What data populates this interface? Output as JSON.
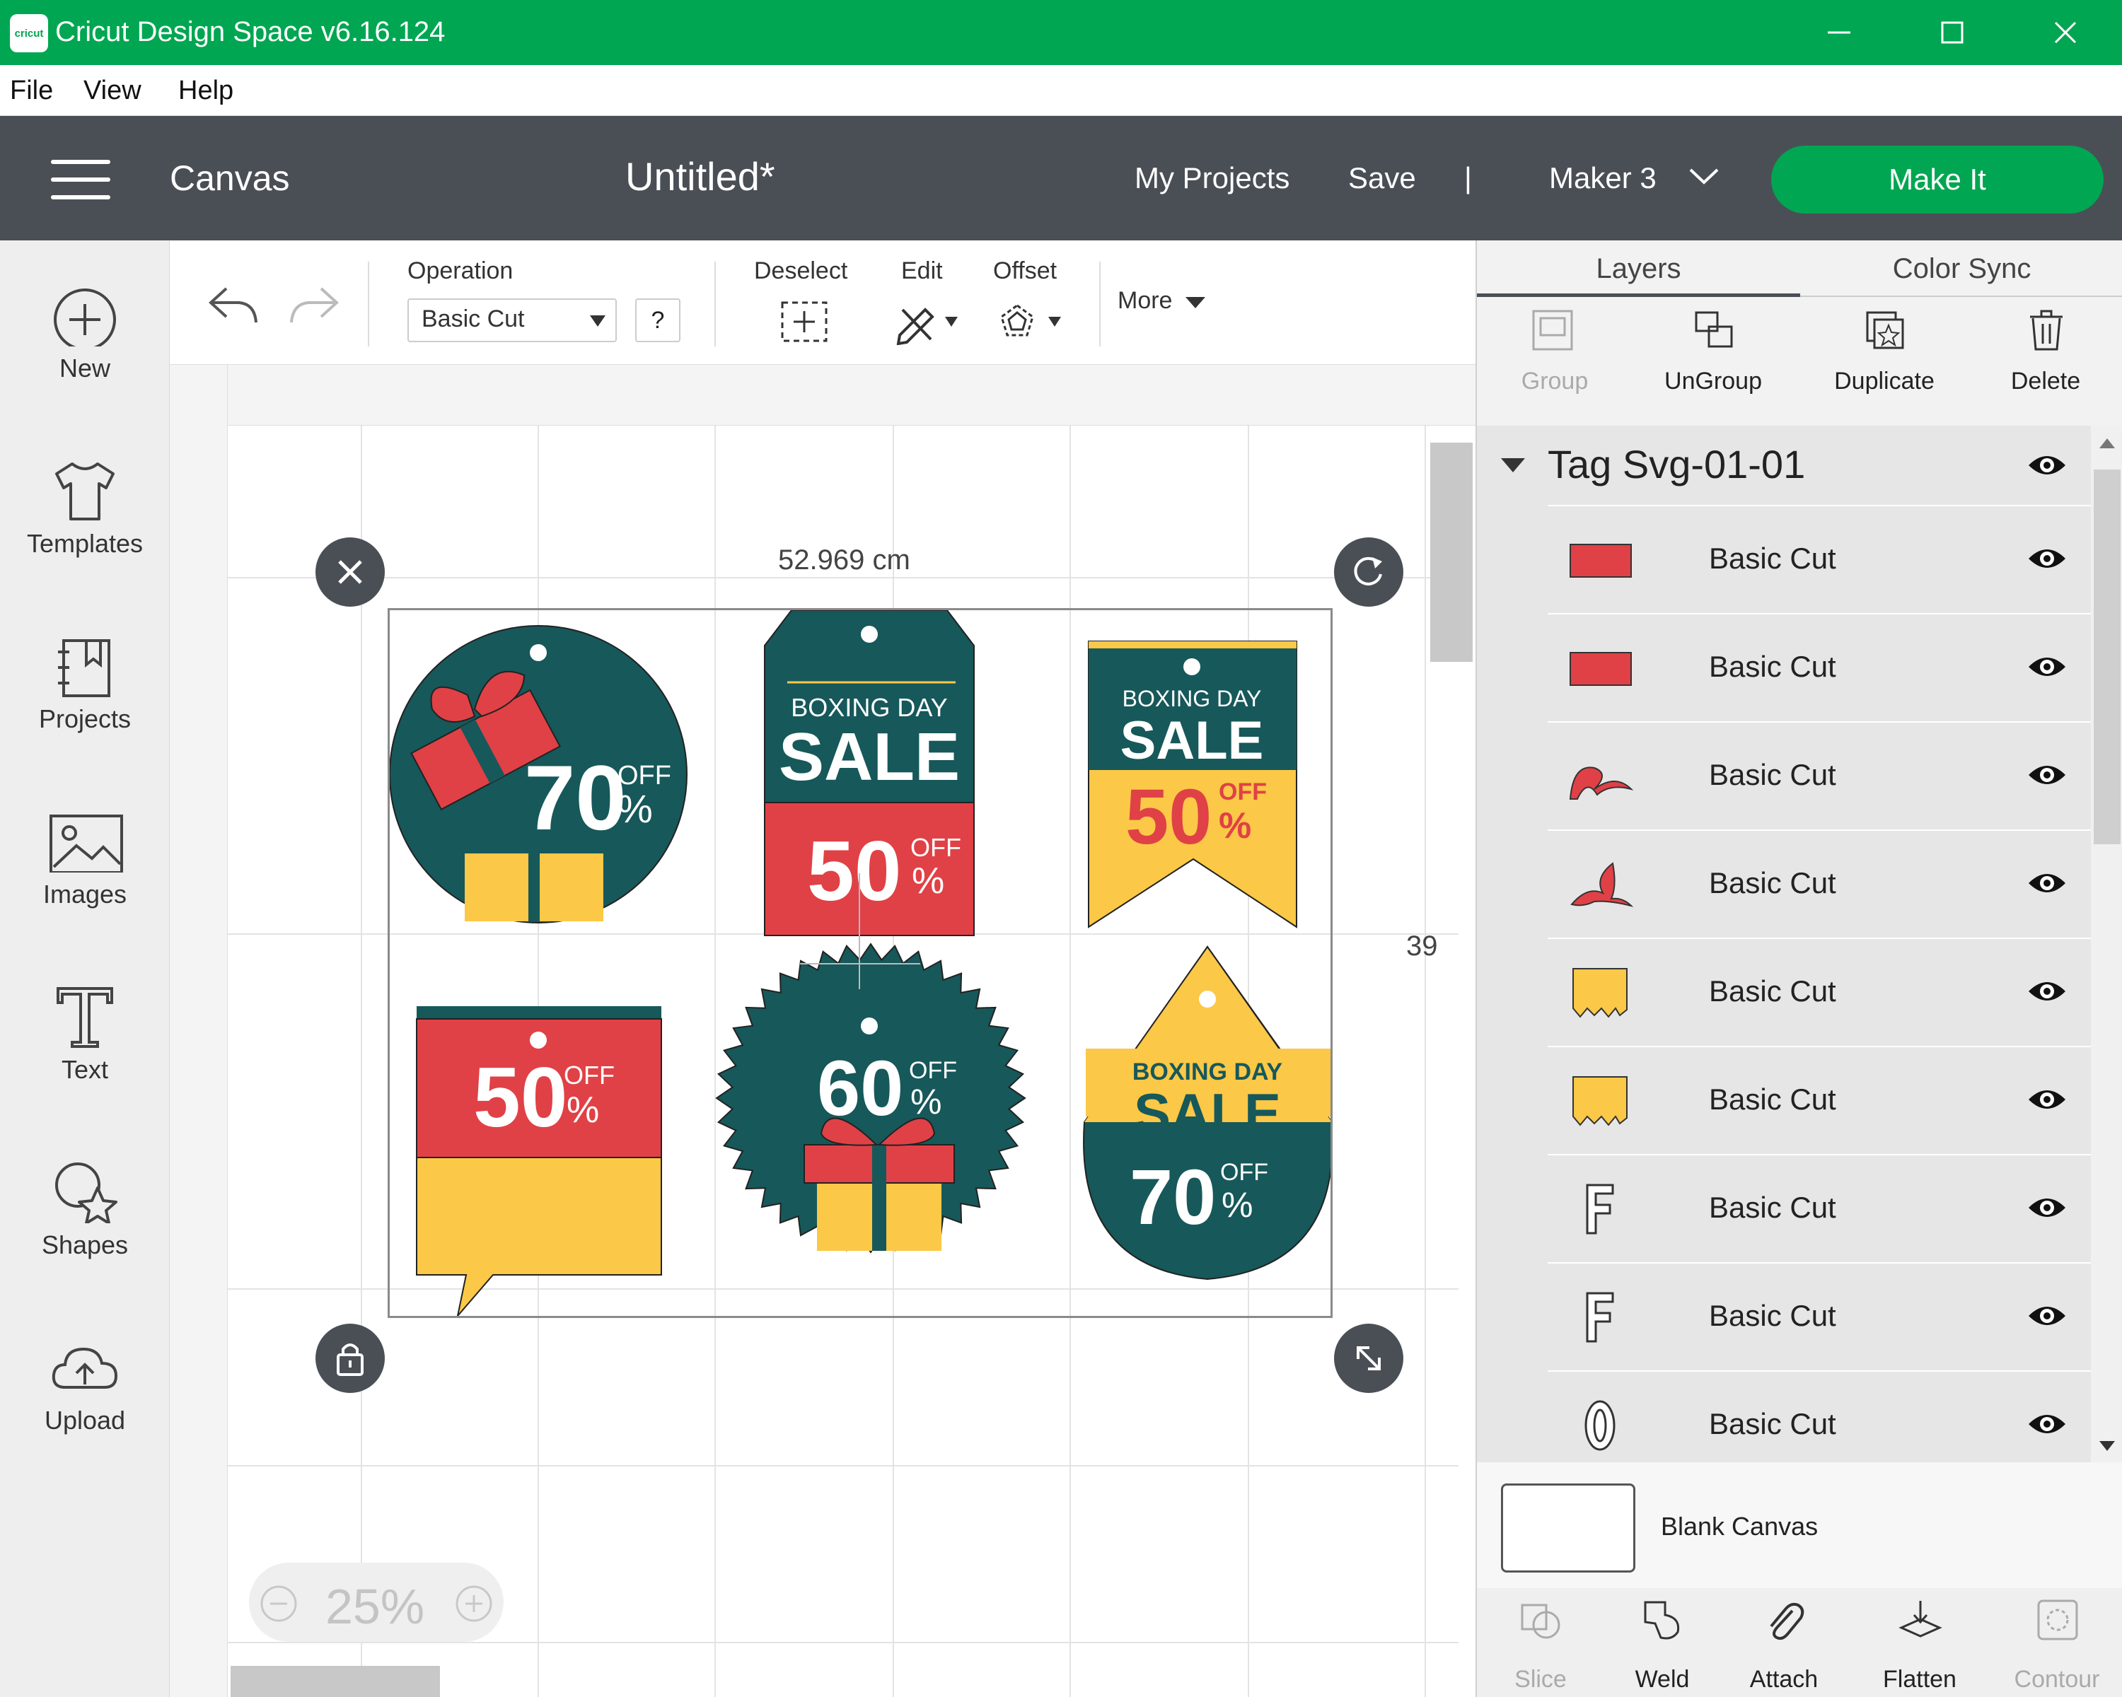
{
  "window": {
    "title": "Cricut Design Space  v6.16.124",
    "logo_text": "cricut"
  },
  "menu": {
    "file": "File",
    "view": "View",
    "help": "Help"
  },
  "header": {
    "section": "Canvas",
    "doc_title": "Untitled*",
    "my_projects": "My Projects",
    "save": "Save",
    "separator": "|",
    "machine": "Maker 3",
    "make_it": "Make It"
  },
  "sidebar": {
    "items": [
      {
        "label": "New",
        "icon": "plus-circle-icon"
      },
      {
        "label": "Templates",
        "icon": "tshirt-icon"
      },
      {
        "label": "Projects",
        "icon": "notebook-icon"
      },
      {
        "label": "Images",
        "icon": "image-icon"
      },
      {
        "label": "Text",
        "icon": "text-icon"
      },
      {
        "label": "Shapes",
        "icon": "shapes-icon"
      },
      {
        "label": "Upload",
        "icon": "cloud-upload-icon"
      }
    ]
  },
  "toolbar": {
    "operation_label": "Operation",
    "operation_value": "Basic Cut",
    "help": "?",
    "deselect": "Deselect",
    "edit": "Edit",
    "offset": "Offset",
    "more": "More"
  },
  "canvas": {
    "width_label": "52.969 cm",
    "height_label": "39",
    "zoom": "25%",
    "tags": {
      "t1_num": "70",
      "t2_top": "BOXING DAY",
      "t2_sale": "SALE",
      "t2_num": "50",
      "t3_top": "BOXING DAY",
      "t3_sale": "SALE",
      "t3_num": "50",
      "t4_num": "50",
      "t5_num": "60",
      "t6_top": "BOXING DAY",
      "t6_sale": "SALE",
      "t6_num": "70",
      "off": "OFF",
      "pct": "%"
    }
  },
  "panel": {
    "tabs": [
      "Layers",
      "Color Sync"
    ],
    "actions": [
      "Group",
      "UnGroup",
      "Duplicate",
      "Delete"
    ],
    "group_name": "Tag Svg-01-01",
    "layers": [
      {
        "name": "Basic Cut",
        "thumb": "red-rect"
      },
      {
        "name": "Basic Cut",
        "thumb": "red-rect"
      },
      {
        "name": "Basic Cut",
        "thumb": "red-ribbon"
      },
      {
        "name": "Basic Cut",
        "thumb": "red-bow"
      },
      {
        "name": "Basic Cut",
        "thumb": "yellow-box"
      },
      {
        "name": "Basic Cut",
        "thumb": "yellow-box"
      },
      {
        "name": "Basic Cut",
        "thumb": "letter-f"
      },
      {
        "name": "Basic Cut",
        "thumb": "letter-f"
      },
      {
        "name": "Basic Cut",
        "thumb": "letter-o"
      }
    ],
    "blank_canvas": "Blank Canvas",
    "bottom_actions": [
      "Slice",
      "Weld",
      "Attach",
      "Flatten",
      "Contour"
    ]
  },
  "colors": {
    "brand_green": "#00a651",
    "header_gray": "#4a4f56",
    "tag_teal": "#17585a",
    "tag_red": "#e04146",
    "tag_yellow": "#fbc847"
  }
}
